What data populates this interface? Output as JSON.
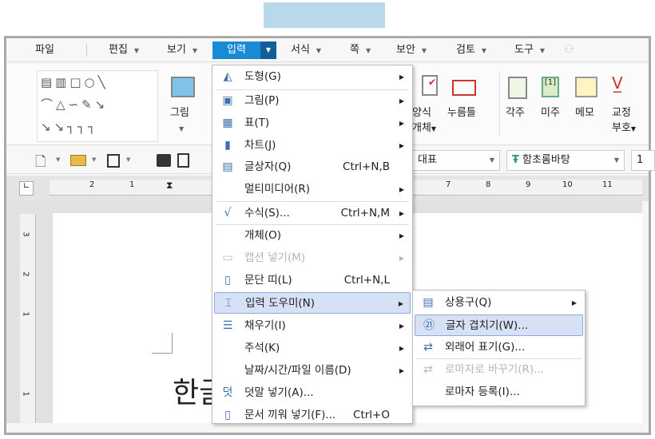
{
  "menubar": {
    "items": [
      {
        "label": "파일"
      },
      {
        "label": "편집"
      },
      {
        "label": "보기"
      },
      {
        "label": "입력",
        "active": true
      },
      {
        "label": "서식"
      },
      {
        "label": "쪽"
      },
      {
        "label": "보안"
      },
      {
        "label": "검토"
      },
      {
        "label": "도구"
      }
    ]
  },
  "ribbon": {
    "picture": "그림",
    "form_object_1": "양식",
    "form_object_2": "개체",
    "press_frame": "누름틀",
    "footnote": "각주",
    "endnote": "미주",
    "memo": "메모",
    "proof_1": "교정",
    "proof_2": "부호"
  },
  "toolbar": {
    "style": "대표",
    "font": "함초롬바탕",
    "size": "1"
  },
  "ruler": {
    "ticks": [
      "2",
      "1",
      "7",
      "8",
      "9",
      "10",
      "11"
    ],
    "vticks": [
      "3",
      "2",
      "1",
      "1"
    ]
  },
  "document": {
    "text": "한글"
  },
  "insert_menu": {
    "items": [
      {
        "label": "도형(G)",
        "icon": "shape-icon",
        "submenu": true
      },
      {
        "label": "그림(P)",
        "icon": "picture-icon",
        "submenu": true
      },
      {
        "label": "표(T)",
        "icon": "table-icon",
        "submenu": true
      },
      {
        "label": "차트(J)",
        "icon": "chart-icon",
        "submenu": true
      },
      {
        "label": "글상자(Q)",
        "icon": "textbox-icon",
        "shortcut": "Ctrl+N,B"
      },
      {
        "label": "멀티미디어(R)",
        "submenu": true
      },
      {
        "label": "수식(S)...",
        "icon": "formula-icon",
        "shortcut": "Ctrl+N,M",
        "submenu": true
      },
      {
        "label": "개체(O)",
        "submenu": true
      },
      {
        "label": "캡션 넣기(M)",
        "icon": "caption-icon",
        "submenu": true,
        "disabled": true
      },
      {
        "label": "문단 띠(L)",
        "icon": "paragraph-band-icon",
        "shortcut": "Ctrl+N,L"
      },
      {
        "label": "입력 도우미(N)",
        "icon": "input-helper-icon",
        "submenu": true,
        "highlighted": true
      },
      {
        "label": "채우기(I)",
        "icon": "fill-icon",
        "submenu": true
      },
      {
        "label": "주석(K)",
        "submenu": true
      },
      {
        "label": "날짜/시간/파일 이름(D)",
        "submenu": true
      },
      {
        "label": "덧말 넣기(A)...",
        "icon": "ruby-text-icon"
      },
      {
        "label": "문서 끼워 넣기(F)...",
        "icon": "insert-document-icon",
        "shortcut": "Ctrl+O"
      }
    ]
  },
  "helper_submenu": {
    "items": [
      {
        "label": "상용구(Q)",
        "icon": "autotext-icon",
        "submenu": true
      },
      {
        "label": "글자 겹치기(W)...",
        "icon": "char-overlap-icon",
        "highlighted": true
      },
      {
        "label": "외래어 표기(G)...",
        "icon": "loanword-icon"
      },
      {
        "label": "로마자로 바꾸기(R)...",
        "icon": "romanize-icon",
        "disabled": true
      },
      {
        "label": "로마자 등록(I)..."
      }
    ]
  },
  "colors": {
    "accent": "#1a8ad4",
    "highlight": "#d6e1f5"
  }
}
